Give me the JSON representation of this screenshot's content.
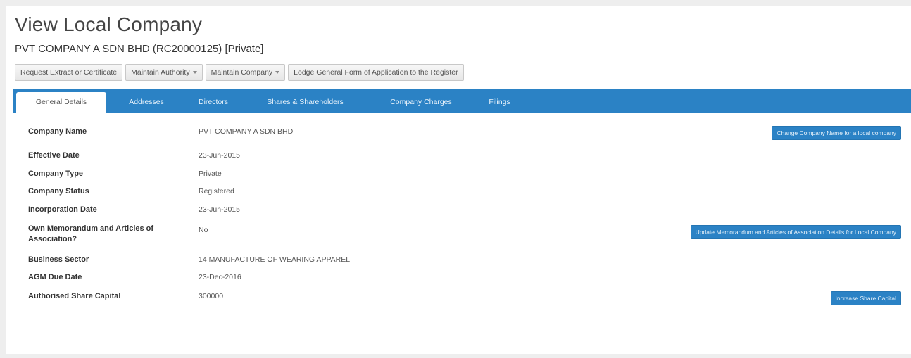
{
  "header": {
    "title": "View Local Company",
    "subtitle": "PVT COMPANY A SDN BHD (RC20000125) [Private]"
  },
  "actions": [
    {
      "label": "Request Extract or Certificate",
      "dropdown": false
    },
    {
      "label": "Maintain Authority",
      "dropdown": true
    },
    {
      "label": "Maintain Company",
      "dropdown": true
    },
    {
      "label": "Lodge General Form of Application to the Register",
      "dropdown": false
    }
  ],
  "tabs": [
    {
      "label": "General Details",
      "active": true
    },
    {
      "label": "Addresses",
      "active": false
    },
    {
      "label": "Directors",
      "active": false
    },
    {
      "label": "Shares & Shareholders",
      "active": false
    },
    {
      "label": "Company Charges",
      "active": false
    },
    {
      "label": "Filings",
      "active": false
    }
  ],
  "details": [
    {
      "label": "Company Name",
      "value": "PVT COMPANY A SDN BHD",
      "action": "Change Company Name for a local company"
    },
    {
      "label": "Effective Date",
      "value": "23-Jun-2015"
    },
    {
      "label": "Company Type",
      "value": "Private"
    },
    {
      "label": "Company Status",
      "value": "Registered"
    },
    {
      "label": "Incorporation Date",
      "value": "23-Jun-2015"
    },
    {
      "label": "Own Memorandum and Articles of Association?",
      "value": "No",
      "action": "Update Memorandum and Articles of Association Details for Local Company"
    },
    {
      "label": "Business Sector",
      "value": "14 MANUFACTURE OF WEARING APPAREL"
    },
    {
      "label": "AGM Due Date",
      "value": "23-Dec-2016"
    },
    {
      "label": "Authorised Share Capital",
      "value": "300000",
      "action": "Increase Share Capital"
    }
  ],
  "colors": {
    "accent": "#2b82c5",
    "background": "#eeeeee",
    "panel": "#ffffff"
  }
}
